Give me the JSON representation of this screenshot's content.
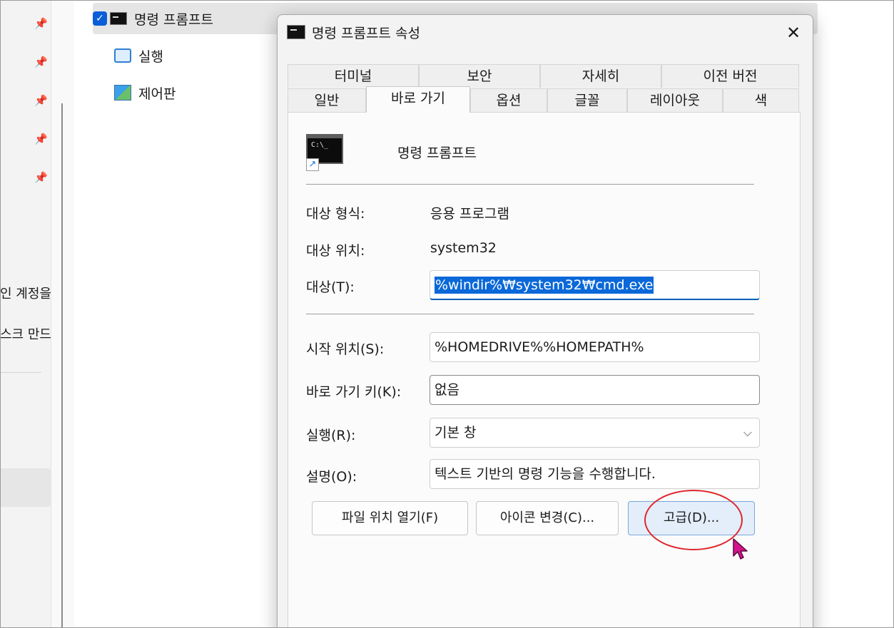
{
  "left_pane": {
    "partial_items": [
      "인 계정을",
      "스크 만드"
    ]
  },
  "list": {
    "items": [
      {
        "label": "명령 프롬프트",
        "selected": true,
        "icon": "cmd-icon"
      },
      {
        "label": "실행",
        "icon": "run-icon"
      },
      {
        "label": "제어판",
        "icon": "control-panel-icon"
      }
    ]
  },
  "dialog": {
    "title": "명령 프롬프트 속성",
    "close_glyph": "✕",
    "tabs_back": [
      "터미널",
      "보안",
      "자세히",
      "이전 버전"
    ],
    "tabs_front": [
      "일반",
      "바로 가기",
      "옵션",
      "글꼴",
      "레이아웃",
      "색"
    ],
    "active_tab": "바로 가기",
    "shortcut_name": "명령 프롬프트",
    "icon_text": "C:\\_",
    "fields": {
      "target_type_label": "대상 형식:",
      "target_type_value": "응용 프로그램",
      "target_location_label": "대상 위치:",
      "target_location_value": "system32",
      "target_label": "대상(T):",
      "target_value": "%windir%₩system32₩cmd.exe",
      "start_in_label": "시작 위치(S):",
      "start_in_value": "%HOMEDRIVE%%HOMEPATH%",
      "shortcut_key_label": "바로 가기 키(K):",
      "shortcut_key_value": "없음",
      "run_label": "실행(R):",
      "run_value": "기본 창",
      "comment_label": "설명(O):",
      "comment_value": "텍스트 기반의 명령 기능을 수행합니다."
    },
    "buttons": {
      "open_location": "파일 위치 열기(F)",
      "change_icon": "아이콘 변경(C)...",
      "advanced": "고급(D)..."
    }
  },
  "colors": {
    "accent": "#0a68d8",
    "annotation": "#e0262d",
    "cursor": "#d4148c"
  }
}
